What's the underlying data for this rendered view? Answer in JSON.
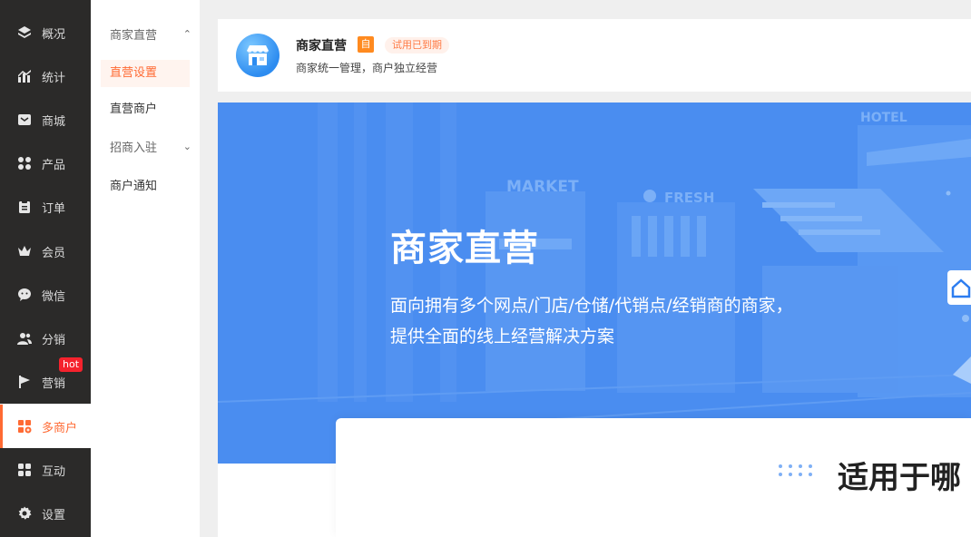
{
  "nav": {
    "items": [
      {
        "label": "概况",
        "icon": "layers-icon"
      },
      {
        "label": "统计",
        "icon": "chart-icon"
      },
      {
        "label": "商城",
        "icon": "mail-icon"
      },
      {
        "label": "产品",
        "icon": "apps-icon"
      },
      {
        "label": "订单",
        "icon": "clipboard-icon"
      },
      {
        "label": "会员",
        "icon": "crown-icon"
      },
      {
        "label": "微信",
        "icon": "wechat-icon"
      },
      {
        "label": "分销",
        "icon": "users-icon"
      },
      {
        "label": "营销",
        "icon": "flag-icon"
      },
      {
        "label": "多商户",
        "icon": "store-icon"
      },
      {
        "label": "互动",
        "icon": "grid-icon"
      },
      {
        "label": "设置",
        "icon": "gear-icon"
      }
    ],
    "hot_badge": "hot",
    "active_color": "#ff6a33"
  },
  "subnav": {
    "group1": "商家直营",
    "item_settings": "直营设置",
    "item_merchants": "直营商户",
    "group2": "招商入驻",
    "item_notice": "商户通知"
  },
  "header": {
    "title": "商家直营",
    "self_badge": "自",
    "trial_badge": "试用已到期",
    "subtitle": "商家统一管理，商户独立经营"
  },
  "banner": {
    "title": "商家直营",
    "description": "面向拥有多个网点/门店/仓储/代销点/经销商的商家，提供全面的线上经营解决方案",
    "signs": [
      "MARKET",
      "FRESH",
      "HOTEL"
    ],
    "color": "#4a8df0"
  },
  "section": {
    "title": "适用于哪"
  }
}
